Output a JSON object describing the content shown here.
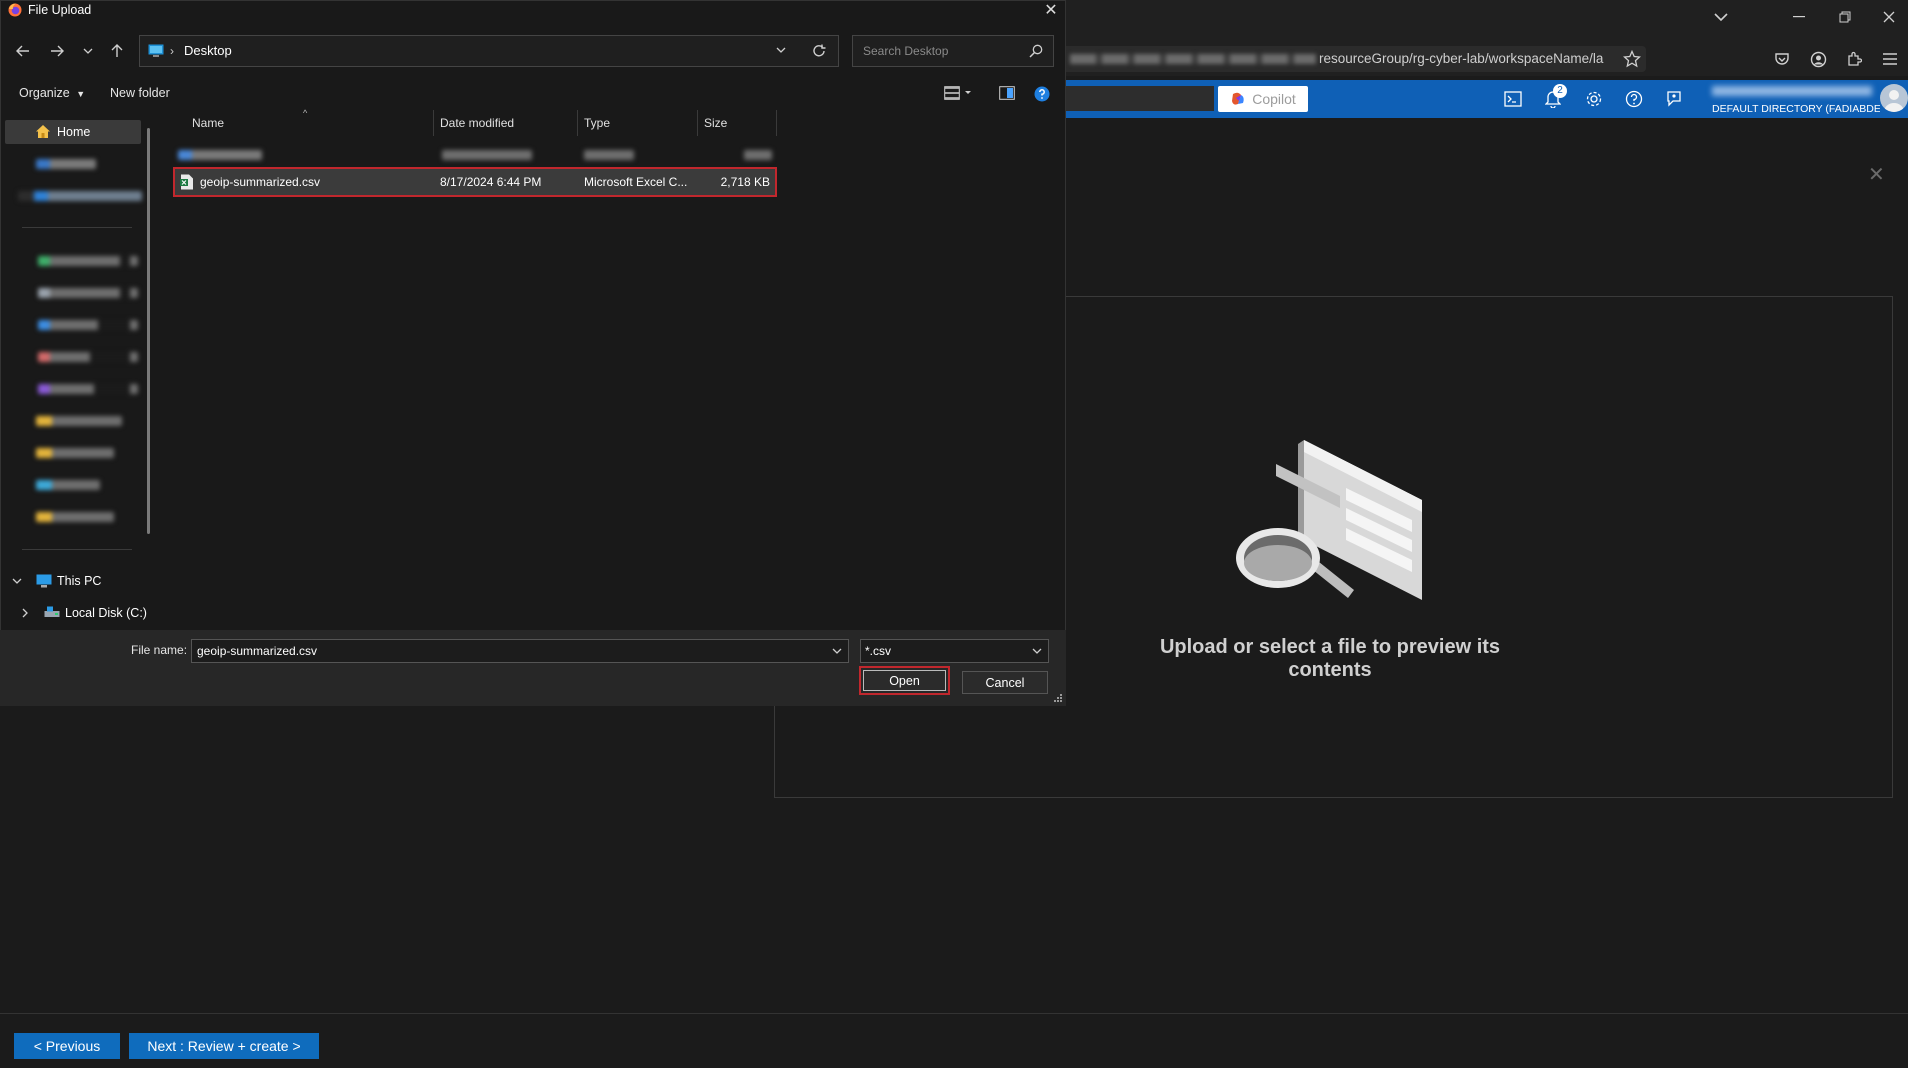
{
  "dialog": {
    "title": "File Upload",
    "address": {
      "location": "Desktop"
    },
    "search": {
      "placeholder": "Search Desktop"
    },
    "toolbar": {
      "organize": "Organize",
      "new_folder": "New folder"
    },
    "nav": {
      "home": "Home",
      "this_pc": "This PC",
      "local_disk": "Local Disk (C:)"
    },
    "columns": {
      "name": "Name",
      "date_modified": "Date modified",
      "type": "Type",
      "size": "Size"
    },
    "selected_file": {
      "name": "geoip-summarized.csv",
      "date_modified": "8/17/2024 6:44 PM",
      "type": "Microsoft Excel C...",
      "size": "2,718 KB"
    },
    "file_name_label": "File name:",
    "file_name_value": "geoip-summarized.csv",
    "file_type_filter": "*.csv",
    "open_label": "Open",
    "cancel_label": "Cancel"
  },
  "browser": {
    "url_visible": "resourceGroup/rg-cyber-lab/workspaceName/la"
  },
  "azure": {
    "copilot_label": "Copilot",
    "notification_count": "2",
    "directory": "DEFAULT DIRECTORY (FADIABDE..."
  },
  "content": {
    "preview_message": "Upload or select a file to preview its contents",
    "previous_label": "< Previous",
    "next_label": "Next : Review + create >"
  },
  "colors": {
    "azure_blue": "#0f60b6",
    "button_blue": "#0f6cbd",
    "highlight_red": "#c1272d"
  }
}
